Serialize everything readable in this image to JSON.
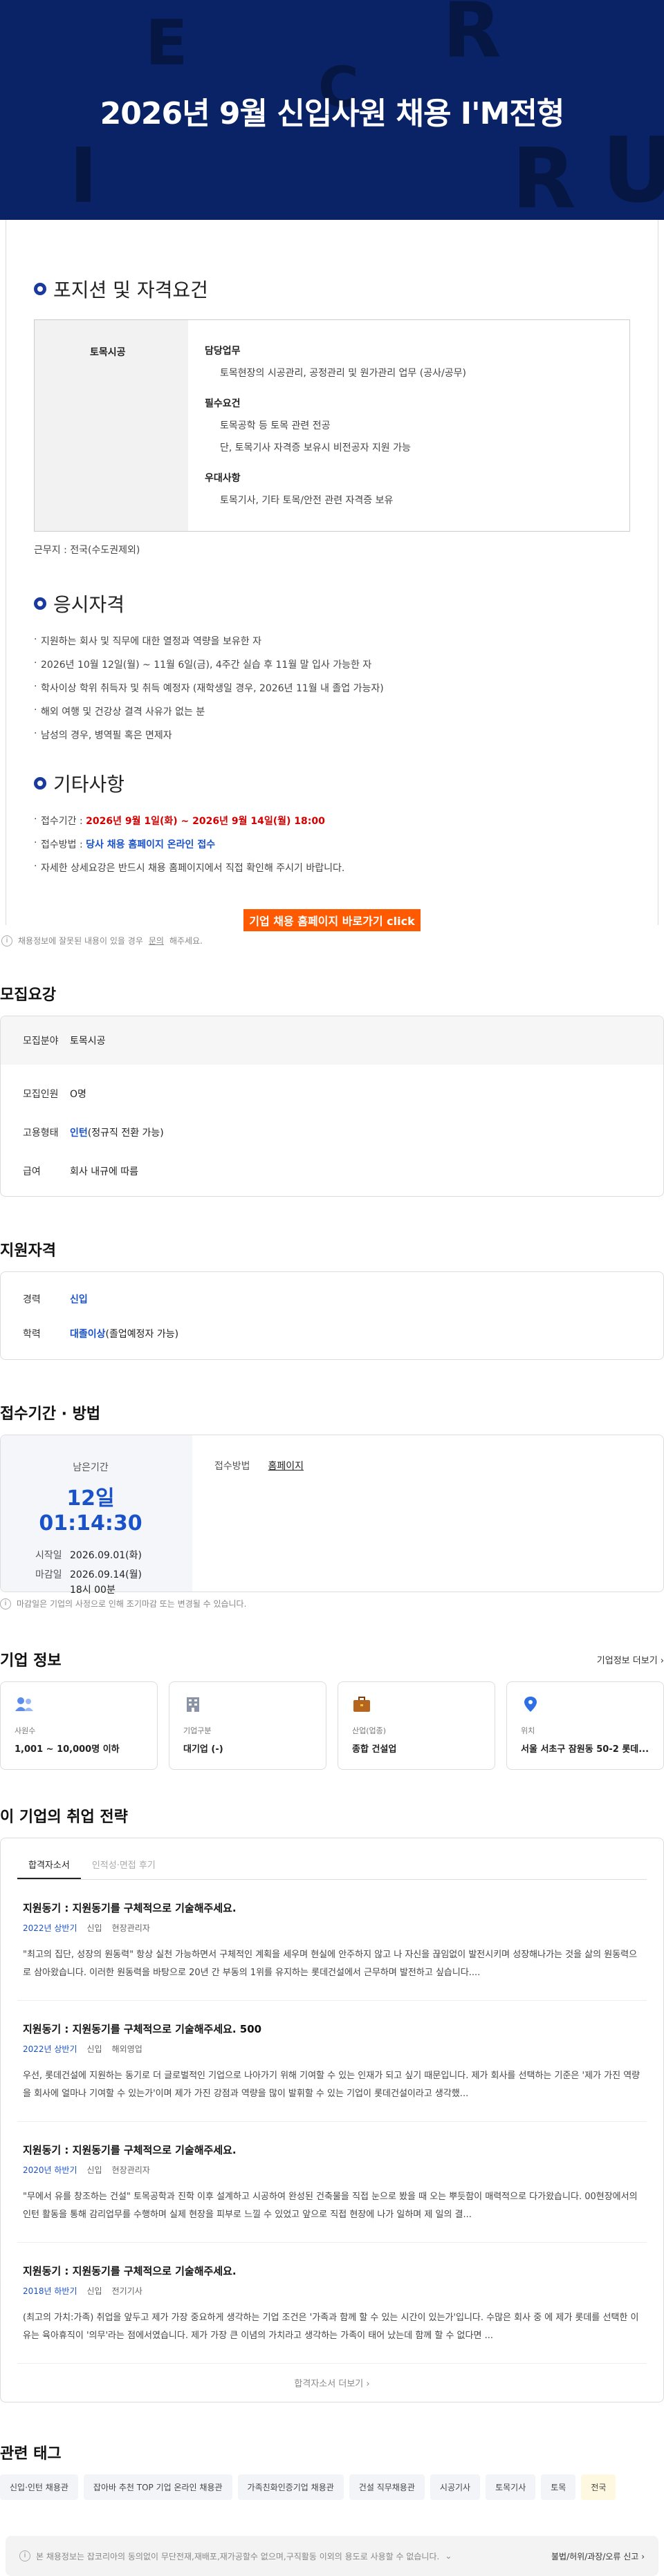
{
  "hero": {
    "title": "2026년 9월 신입사원 채용 I'M전형",
    "bg_letters": [
      "E",
      "R",
      "C",
      "I",
      "R",
      "U",
      "_"
    ]
  },
  "notice": {
    "position_section_title": "포지션 및 자격요건",
    "position": {
      "name": "토목시공",
      "groups": [
        {
          "title": "담당업무",
          "lines": [
            "토목현장의 시공관리, 공정관리 및 원가관리 업무 (공사/공무)"
          ]
        },
        {
          "title": "필수요건",
          "lines": [
            "토목공학 등 토목 관련 전공",
            "단, 토목기사 자격증 보유시 비전공자 지원 가능"
          ]
        },
        {
          "title": "우대사항",
          "lines": [
            "토목기사, 기타 토목/안전 관련 자격증 보유"
          ]
        }
      ],
      "location": "근무지 : 전국(수도권제외)"
    },
    "eligibility_title": "응시자격",
    "eligibility": [
      "지원하는 회사 및 직무에 대한 열정과 역량을 보유한 자",
      "2026년 10월 12일(월) ~ 11월 6일(금), 4주간 실습 후 11월 말 입사 가능한 자",
      "학사이상 학위 취득자 및 취득 예정자 (재학생일 경우, 2026년 11월 내 졸업 가능자)",
      "해외 여행 및 건강상 결격 사유가 없는 분",
      "남성의 경우, 병역필 혹은 면제자"
    ],
    "etc_title": "기타사항",
    "etc": {
      "period_label": "접수기간 : ",
      "period_value": "2026년 9월 1일(화) ~ 2026년 9월 14일(월) 18:00",
      "method_label": "접수방법 : ",
      "method_value": "당사 채용 홈페이지 온라인 접수",
      "detail": "자세한 상세요강은 반드시 채용 홈페이지에서 직접 확인해 주시기 바랍니다."
    },
    "cta_label": "기업 채용 홈페이지 바로가기 click"
  },
  "report_note": {
    "pre": "채용정보에 잘못된 내용이 있을 경우 ",
    "link": "문의",
    "post": "해주세요."
  },
  "recruit": {
    "title": "모집요강",
    "field_label": "모집분야",
    "field_value": "토목시공",
    "rows": [
      {
        "k": "모집인원",
        "v": "O명",
        "blue": ""
      },
      {
        "k": "고용형태",
        "blue": "인턴",
        "v": "(정규직 전환 가능)"
      },
      {
        "k": "급여",
        "v": "회사 내규에 따름",
        "blue": ""
      }
    ]
  },
  "qualify": {
    "title": "지원자격",
    "rows": [
      {
        "k": "경력",
        "blue": "신입",
        "v": ""
      },
      {
        "k": "학력",
        "blue": "대졸이상",
        "v": " (졸업예정자 가능)"
      }
    ]
  },
  "deadline": {
    "title": "접수기간 · 방법",
    "remaining_label": "남은기간",
    "remaining_value": "12일 01:14:30",
    "start_label": "시작일",
    "start_value": "2026.09.01(화)",
    "end_label": "마감일",
    "end_value": "2026.09.14(월)",
    "end_time": "18시 00분",
    "method_label": "접수방법",
    "method_value": "홈페이지",
    "note": "마감일은 기업의 사정으로 인해 조기마감 또는 변경될 수 있습니다."
  },
  "company": {
    "title": "기업 정보",
    "more": "기업정보 더보기",
    "cards": [
      {
        "icon": "people-icon",
        "label": "사원수",
        "value": "1,001 ~ 10,000명 이하"
      },
      {
        "icon": "building-icon",
        "label": "기업구분",
        "value": "대기업 (-)"
      },
      {
        "icon": "briefcase-icon",
        "label": "산업(업종)",
        "value": "종합 건설업"
      },
      {
        "icon": "pin-icon",
        "label": "위치",
        "value": "서울 서초구 잠원동 50-2 롯데..."
      }
    ],
    "colors": {
      "people": "#5b8def",
      "building": "#8a94a6",
      "briefcase": "#b5651d",
      "pin": "#2f6fe4"
    }
  },
  "strategy": {
    "title": "이 기업의 취업 전략",
    "tabs": [
      "합격자소서",
      "인적성·면접 후기"
    ],
    "essays": [
      {
        "q": "지원동기 : 지원동기를 구체적으로 기술해주세요.",
        "year": "2022년 상반기",
        "type": "신입",
        "job": "현장관리자",
        "body": "\"최고의 집단, 성장의 원동력\" 항상 실천 가능하면서 구체적인 계획을 세우며 현실에 안주하지 않고 나 자신을 끊임없이 발전시키며 성장해나가는 것을 삶의 원동력으로 삼아왔습니다. 이러한 원동력을 바탕으로 20년 간 부동의 1위를 유지하는 롯데건설에서 근무하며 발전하고 싶습니다...."
      },
      {
        "q": "지원동기 : 지원동기를 구체적으로 기술해주세요. 500",
        "year": "2022년 상반기",
        "type": "신입",
        "job": "해외영업",
        "body": "우선, 롯데건설에 지원하는 동기로 더 글로벌적인 기업으로 나아가기 위해 기여할 수 있는 인재가 되고 싶기 때문입니다. 제가 회사를 선택하는 기준은 '제가 가진 역량을 회사에 얼마나 기여할 수 있는가'이며 제가 가진 강점과 역량을 많이 발휘할 수 있는 기업이 롯데건설이라고 생각했..."
      },
      {
        "q": "지원동기 : 지원동기를 구체적으로 기술해주세요.",
        "year": "2020년 하반기",
        "type": "신입",
        "job": "현장관리자",
        "body": "\"무에서 유를 창조하는 건설\" 토목공학과 진학 이후 설계하고 시공하여 완성된 건축물을 직접 눈으로 봤을 때 오는 뿌듯함이 매력적으로 다가왔습니다. 00현장에서의 인턴 활동을 통해 감리업무를 수행하며 실제 현장을 피부로 느낄 수 있었고 앞으로 직접 현장에 나가 일하며 제 일의 결..."
      },
      {
        "q": "지원동기 : 지원동기를 구체적으로 기술해주세요.",
        "year": "2018년 하반기",
        "type": "신입",
        "job": "전기기사",
        "body": "(최고의 가치:가족) 취업을 앞두고 제가 가장 중요하게 생각하는 기업 조건은 '가족과 함께 할 수 있는 시간이 있는가'입니다. 수많은 회사 중 에 제가 롯데를 선택한 이유는 육아휴직이 '의무'라는 점에서였습니다. 제가 가장 큰 이념의 가치라고 생각하는 가족이 태어 났는데 함께 할 수 없다면 ..."
      }
    ],
    "more": "합격자소서 더보기"
  },
  "tags": {
    "title": "관련 태그",
    "items": [
      "신입·인턴 채용관",
      "잡아바 추천 TOP 기업 온라인 채용관",
      "가족친화인증기업 채용관",
      "건설 직무채용관",
      "시공기사",
      "토목기사",
      "토목",
      "전국"
    ]
  },
  "footer": {
    "left": "본 채용정보는 잡코리아의 동의없이 무단전재,재배포,재가공할수 없으며,구직활동 이외의 용도로 사용할 수 없습니다.",
    "right": "불법/허위/과장/오류 신고"
  }
}
